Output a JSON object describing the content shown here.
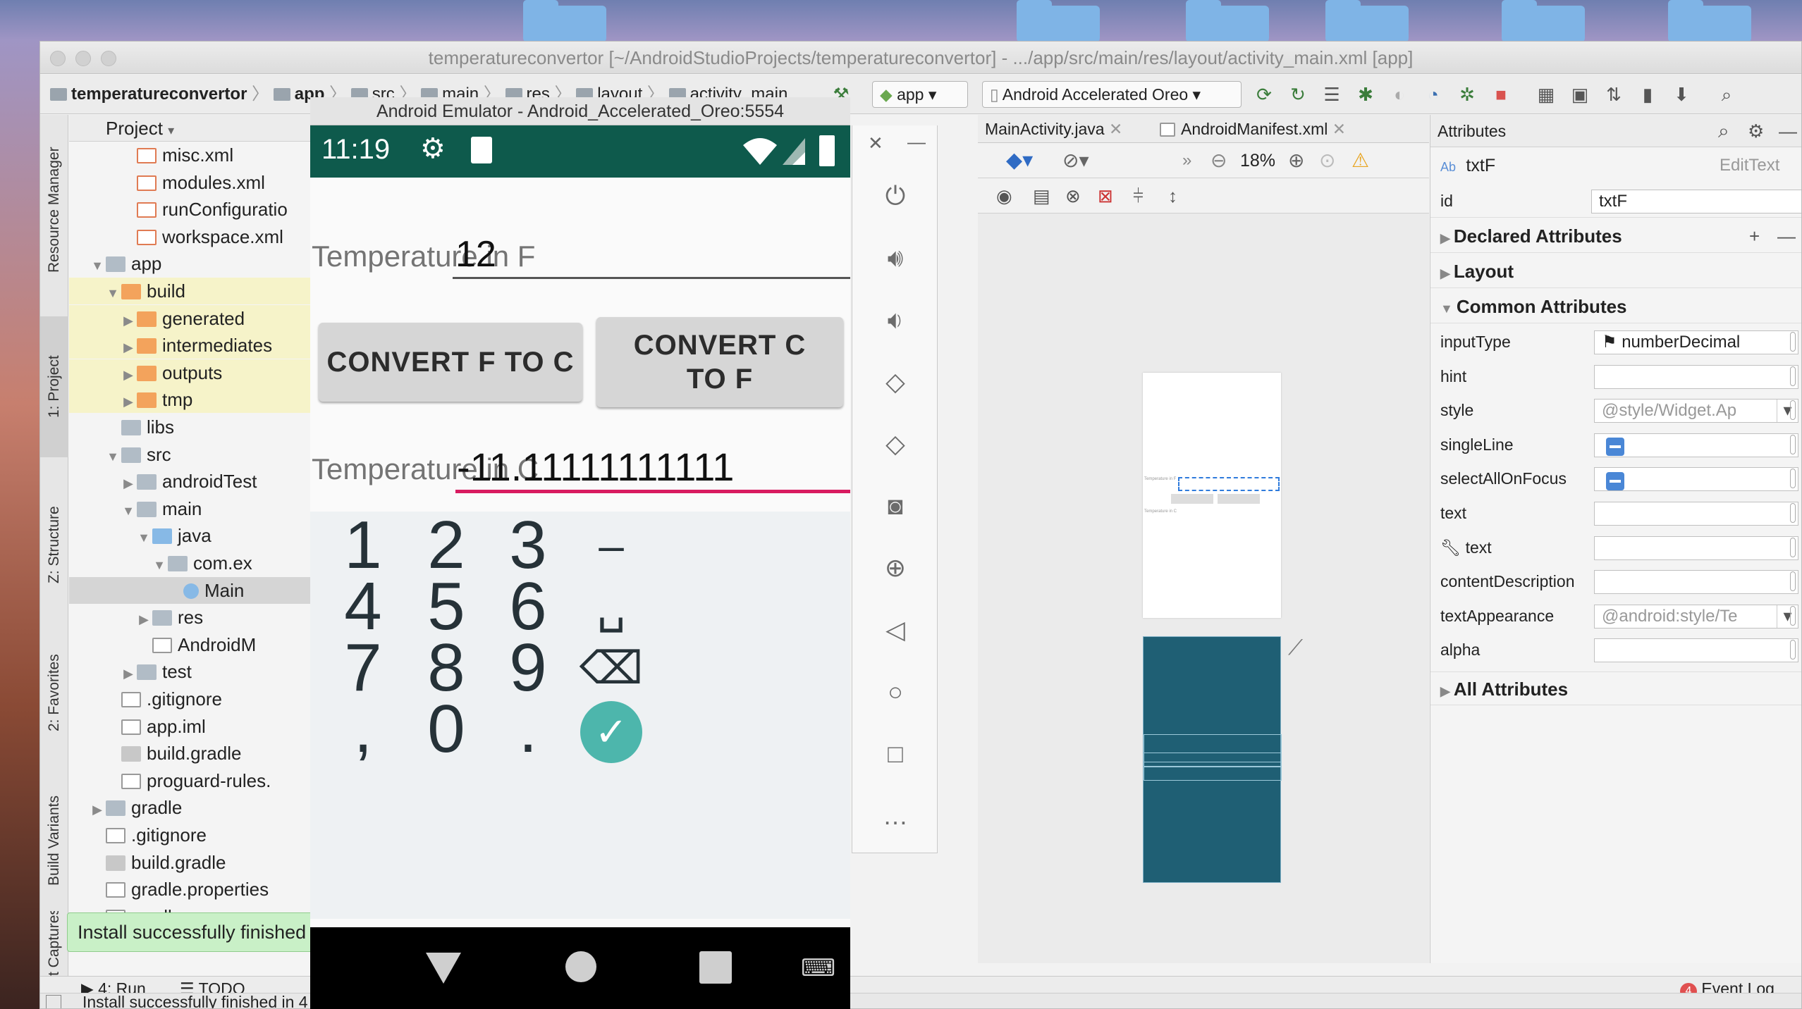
{
  "window": {
    "title": "temperatureconvertor [~/AndroidStudioProjects/temperatureconvertor] - .../app/src/main/res/layout/activity_main.xml [app]"
  },
  "breadcrumb": [
    "temperatureconvertor",
    "app",
    "src",
    "main",
    "res",
    "layout",
    "activity_main."
  ],
  "toolbar": {
    "module": "app",
    "device": "Android Accelerated Oreo"
  },
  "left_strip": [
    "Resource Manager",
    "1: Project",
    "Z: Structure",
    "2: Favorites",
    "Build Variants",
    "t Captures"
  ],
  "project_panel": {
    "title": "Project",
    "items": [
      {
        "label": "misc.xml",
        "depth": 3,
        "icon": "xml",
        "arrow": ""
      },
      {
        "label": "modules.xml",
        "depth": 3,
        "icon": "xml",
        "arrow": ""
      },
      {
        "label": "runConfiguratio",
        "depth": 3,
        "icon": "xml",
        "arrow": ""
      },
      {
        "label": "workspace.xml",
        "depth": 3,
        "icon": "xml",
        "arrow": ""
      },
      {
        "label": "app",
        "depth": 1,
        "icon": "folder",
        "arrow": "▼"
      },
      {
        "label": "build",
        "depth": 2,
        "icon": "orange",
        "arrow": "▼"
      },
      {
        "label": "generated",
        "depth": 3,
        "icon": "orange",
        "arrow": "▶"
      },
      {
        "label": "intermediates",
        "depth": 3,
        "icon": "orange",
        "arrow": "▶"
      },
      {
        "label": "outputs",
        "depth": 3,
        "icon": "orange",
        "arrow": "▶"
      },
      {
        "label": "tmp",
        "depth": 3,
        "icon": "orange",
        "arrow": "▶"
      },
      {
        "label": "libs",
        "depth": 2,
        "icon": "folder",
        "arrow": ""
      },
      {
        "label": "src",
        "depth": 2,
        "icon": "folder",
        "arrow": "▼"
      },
      {
        "label": "androidTest",
        "depth": 3,
        "icon": "folder",
        "arrow": "▶"
      },
      {
        "label": "main",
        "depth": 3,
        "icon": "folder",
        "arrow": "▼"
      },
      {
        "label": "java",
        "depth": 4,
        "icon": "blue",
        "arrow": "▼"
      },
      {
        "label": "com.ex",
        "depth": 5,
        "icon": "folder",
        "arrow": "▼"
      },
      {
        "label": "Main",
        "depth": 6,
        "icon": "class",
        "arrow": ""
      },
      {
        "label": "res",
        "depth": 4,
        "icon": "folder",
        "arrow": "▶"
      },
      {
        "label": "AndroidM",
        "depth": 4,
        "icon": "manifest",
        "arrow": ""
      },
      {
        "label": "test",
        "depth": 3,
        "icon": "folder",
        "arrow": "▶"
      },
      {
        "label": ".gitignore",
        "depth": 2,
        "icon": "doc",
        "arrow": ""
      },
      {
        "label": "app.iml",
        "depth": 2,
        "icon": "doc",
        "arrow": ""
      },
      {
        "label": "build.gradle",
        "depth": 2,
        "icon": "gradle",
        "arrow": ""
      },
      {
        "label": "proguard-rules.",
        "depth": 2,
        "icon": "doc",
        "arrow": ""
      },
      {
        "label": "gradle",
        "depth": 1,
        "icon": "folder",
        "arrow": "▶"
      },
      {
        "label": ".gitignore",
        "depth": 1,
        "icon": "doc",
        "arrow": ""
      },
      {
        "label": "build.gradle",
        "depth": 1,
        "icon": "gradle",
        "arrow": ""
      },
      {
        "label": "gradle.properties",
        "depth": 1,
        "icon": "doc",
        "arrow": ""
      },
      {
        "label": "gradlew",
        "depth": 1,
        "icon": "doc",
        "arrow": ""
      }
    ]
  },
  "emulator": {
    "title": "Android Emulator - Android_Accelerated_Oreo:5554",
    "time": "11:19",
    "fahrenheit_label": "Temperature in F",
    "fahrenheit_value": "12",
    "btn_f_to_c": "CONVERT F TO C",
    "btn_c_to_f": "CONVERT C TO F",
    "celsius_label": "Temperature in C",
    "celsius_value": "-11.11111111111",
    "keys": [
      "1",
      "2",
      "3",
      "–",
      "4",
      "5",
      "6",
      "␣",
      "7",
      "8",
      "9",
      "⌫",
      ",",
      "0",
      ".",
      "✓"
    ]
  },
  "editor_tabs": [
    "MainActivity.java",
    "AndroidManifest.xml"
  ],
  "design_toolbar": {
    "zoom": "18%"
  },
  "attributes_panel": {
    "title": "Attributes",
    "widget_name": "txtF",
    "widget_type": "EditText",
    "id_label": "id",
    "id_value": "txtF",
    "sections": {
      "declared": "Declared Attributes",
      "layout": "Layout",
      "common": "Common Attributes",
      "all": "All Attributes"
    },
    "rows": [
      {
        "name": "inputType",
        "value": "numberDecimal",
        "kind": "flag"
      },
      {
        "name": "hint",
        "value": "",
        "kind": "text"
      },
      {
        "name": "style",
        "value": "@style/Widget.Ap",
        "kind": "dropdown"
      },
      {
        "name": "singleLine",
        "value": "",
        "kind": "check"
      },
      {
        "name": "selectAllOnFocus",
        "value": "",
        "kind": "check"
      },
      {
        "name": "text",
        "value": "",
        "kind": "text"
      },
      {
        "name": "text",
        "value": "",
        "kind": "tool"
      },
      {
        "name": "contentDescription",
        "value": "",
        "kind": "text"
      },
      {
        "name": "textAppearance",
        "value": "@android:style/Te",
        "kind": "dropdown"
      },
      {
        "name": "alpha",
        "value": "",
        "kind": "text"
      }
    ]
  },
  "bottom_tabs": {
    "run": "4: Run",
    "todo": "TODO",
    "event_log": "Event Log",
    "event_count": "4"
  },
  "toast": "Install successfully finished",
  "status_text": "Install successfully finished in 4",
  "colors": {
    "status_bar": "#0e5a4c",
    "accent": "#d81b60",
    "check_fab": "#4db6ac"
  }
}
